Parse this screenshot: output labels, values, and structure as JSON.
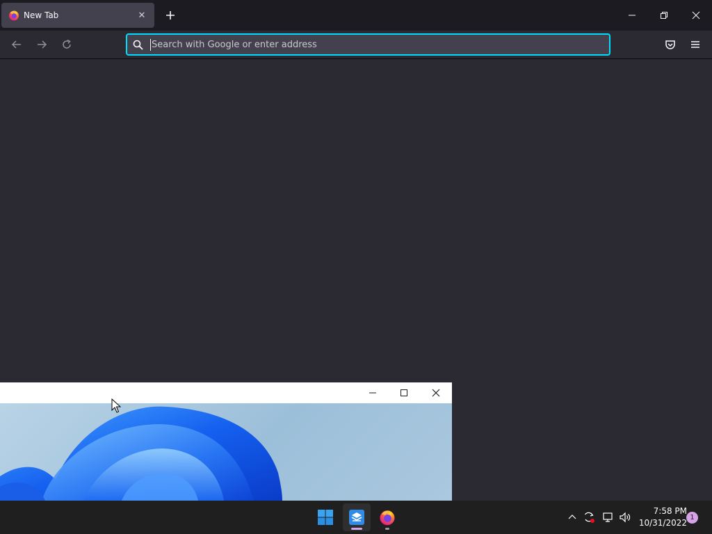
{
  "browser": {
    "tab": {
      "title": "New Tab",
      "close_glyph": "✕",
      "favicon": "firefox-icon"
    },
    "new_tab_glyph": "+",
    "window_controls": {
      "minimize": "minimize-icon",
      "restore": "restore-icon",
      "close": "close-icon"
    },
    "nav": {
      "back": "back-arrow-icon",
      "forward": "forward-arrow-icon",
      "reload": "reload-icon"
    },
    "urlbar": {
      "placeholder": "Search with Google or enter address",
      "value": ""
    },
    "toolbar": {
      "pocket": "pocket-icon",
      "menu": "hamburger-menu-icon"
    }
  },
  "photo_window": {
    "title": "",
    "controls": {
      "minimize": "minimize-icon",
      "maximize": "maximize-icon",
      "close": "close-icon"
    },
    "wallpaper": "windows-11-bloom-wallpaper"
  },
  "taskbar": {
    "apps": [
      {
        "name": "start-button",
        "icon": "windows-logo-icon"
      },
      {
        "name": "app-store-app",
        "icon": "store-app-icon",
        "active": true
      },
      {
        "name": "firefox-app",
        "icon": "firefox-icon",
        "running": true
      }
    ],
    "tray": {
      "chevron": "show-hidden-icons-icon",
      "sync": "sync-icon",
      "network": "network-icon",
      "volume": "volume-icon"
    },
    "clock": {
      "time": "7:58 PM",
      "date": "10/31/2022"
    },
    "notifications": {
      "count": "1"
    }
  },
  "colors": {
    "accent_focus": "#00ddff",
    "browser_bg": "#2b2a33",
    "tabstrip_bg": "#1c1b22",
    "taskbar_bg": "#1f1f1f",
    "indicator_active": "#d6a2e8"
  }
}
